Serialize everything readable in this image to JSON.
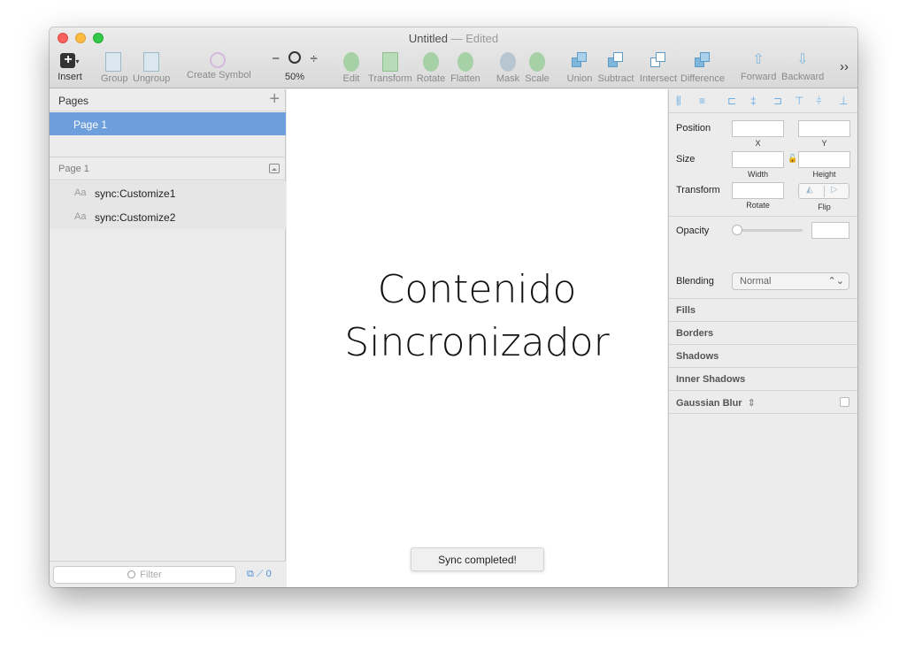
{
  "window": {
    "title": "Untitled",
    "separator": "—",
    "status": "Edited"
  },
  "toolbar": {
    "insert": "Insert",
    "group": "Group",
    "ungroup": "Ungroup",
    "create_symbol": "Create Symbol",
    "zoom_out": "−",
    "zoom_in": "÷",
    "zoom": "50%",
    "edit": "Edit",
    "transform": "Transform",
    "rotate": "Rotate",
    "flatten": "Flatten",
    "mask": "Mask",
    "scale": "Scale",
    "union": "Union",
    "subtract": "Subtract",
    "intersect": "Intersect",
    "difference": "Difference",
    "forward": "Forward",
    "backward": "Backward",
    "more": "››"
  },
  "sidebar": {
    "pages_title": "Pages",
    "add": "+",
    "pages": [
      {
        "label": "Page 1"
      }
    ],
    "layers_title": "Page 1",
    "layers": [
      {
        "type_glyph": "Aa",
        "name": "sync:Customize1"
      },
      {
        "type_glyph": "Aa",
        "name": "sync:Customize2"
      }
    ],
    "filter_placeholder": "Filter",
    "badge_count": "0"
  },
  "canvas": {
    "line1": "Contenido",
    "line2": "Sincronizador",
    "toast": "Sync completed!"
  },
  "inspector": {
    "position": "Position",
    "x": "X",
    "y": "Y",
    "size": "Size",
    "width": "Width",
    "height": "Height",
    "transform": "Transform",
    "rotate": "Rotate",
    "flip": "Flip",
    "opacity": "Opacity",
    "blending": "Blending",
    "blending_value": "Normal",
    "sections": [
      "Fills",
      "Borders",
      "Shadows",
      "Inner Shadows",
      "Gaussian Blur"
    ]
  },
  "colors": {
    "selection": "#6d9fdc",
    "accent": "#4a8ed8"
  }
}
